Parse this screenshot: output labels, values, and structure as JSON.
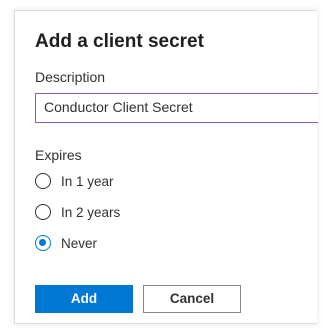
{
  "dialog": {
    "title": "Add a client secret",
    "description_label": "Description",
    "description_value": "Conductor Client Secret",
    "expires_label": "Expires",
    "expires_options": [
      {
        "label": "In 1 year",
        "checked": false
      },
      {
        "label": "In 2 years",
        "checked": false
      },
      {
        "label": "Never",
        "checked": true
      }
    ],
    "add_label": "Add",
    "cancel_label": "Cancel"
  },
  "colors": {
    "accent": "#0078d4",
    "input_focus_border": "#8a5dc6"
  }
}
